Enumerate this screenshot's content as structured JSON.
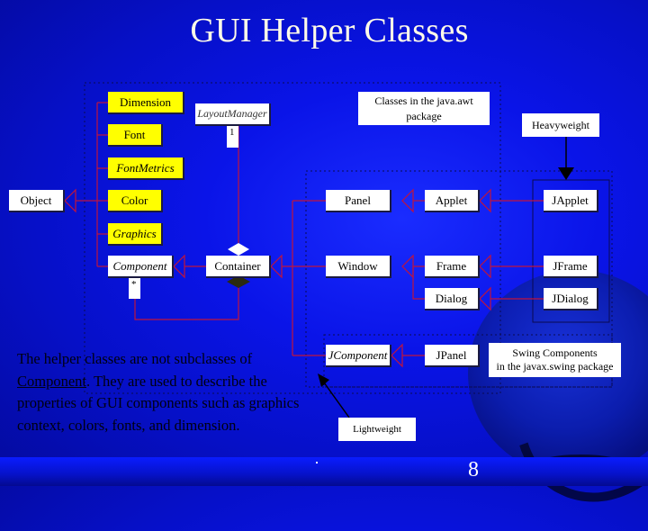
{
  "title": "GUI Helper Classes",
  "classes": {
    "object": "Object",
    "dimension": "Dimension",
    "font": "Font",
    "font_metrics": "FontMetrics",
    "color": "Color",
    "graphics": "Graphics",
    "component": "Component",
    "layout_manager": "LayoutManager",
    "container": "Container",
    "panel": "Panel",
    "window": "Window",
    "applet": "Applet",
    "frame": "Frame",
    "dialog": "Dialog",
    "jcomponent": "JComponent",
    "jpanel": "JPanel",
    "japplet": "JApplet",
    "jframe": "JFrame",
    "jdialog": "JDialog"
  },
  "multiplicity": {
    "layout_manager": "1",
    "component": "*"
  },
  "notes": {
    "awt_package_line1": "Classes in the java.awt",
    "awt_package_line2": "package",
    "heavyweight": "Heavyweight",
    "lightweight": "Lightweight",
    "swing_line1": "Swing Components",
    "swing_line2": "in the javax.swing package"
  },
  "helper_text": {
    "before": "The helper classes are not subclasses of ",
    "link": "Component",
    "after": ". They are used to describe the properties of GUI components such as graphics context, colors, fonts, and dimension."
  },
  "page_number": "8",
  "colors": {
    "background": "#0a14e8",
    "helper_class_fill": "#ffff00",
    "connector": "#c0143c",
    "title_text": "#fffbe8"
  }
}
